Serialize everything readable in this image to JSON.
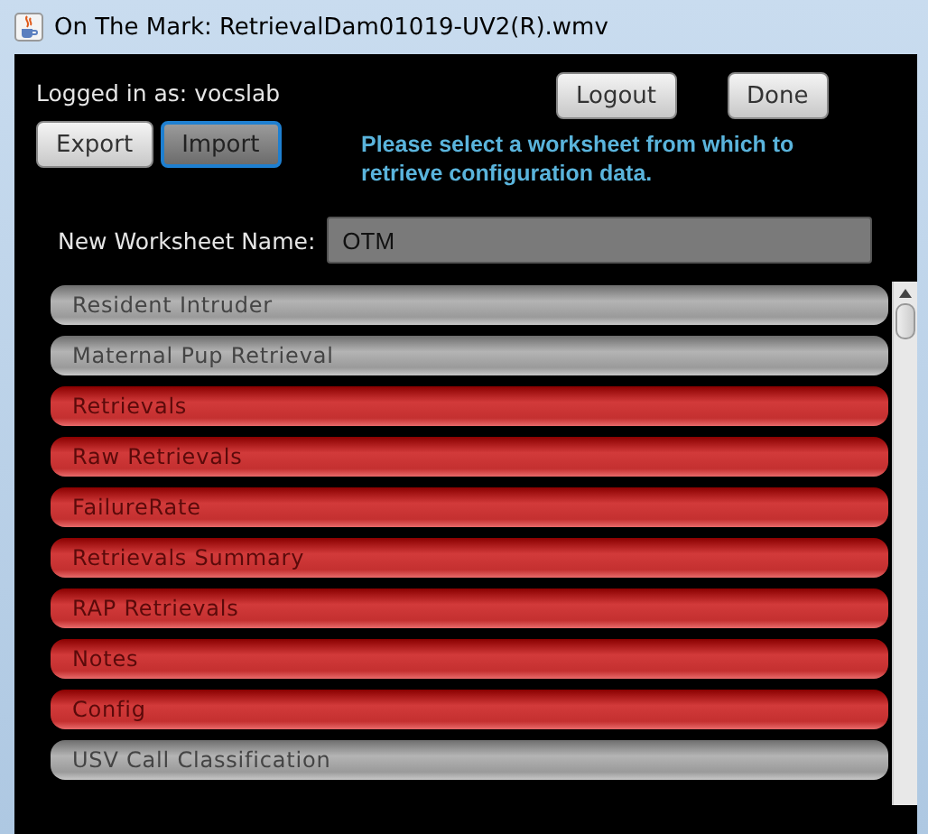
{
  "window": {
    "title": "On The Mark: RetrievalDam01019-UV2(R).wmv"
  },
  "login": {
    "label": "Logged in as: vocslab"
  },
  "top_buttons": [
    {
      "label": "Logout",
      "focused": false
    },
    {
      "label": "Done",
      "focused": false
    }
  ],
  "mode_buttons": [
    {
      "label": "Export",
      "focused": false
    },
    {
      "label": "Import",
      "focused": true
    }
  ],
  "message": "Please select a worksheet from which to retrieve configuration data.",
  "worksheet_name": {
    "label": "New Worksheet Name:",
    "value": "OTM"
  },
  "items": [
    {
      "label": "Resident Intruder",
      "kind": "workbook"
    },
    {
      "label": "Maternal Pup Retrieval",
      "kind": "workbook"
    },
    {
      "label": "Retrievals",
      "kind": "sheet"
    },
    {
      "label": "Raw Retrievals",
      "kind": "sheet"
    },
    {
      "label": "FailureRate",
      "kind": "sheet"
    },
    {
      "label": "Retrievals Summary",
      "kind": "sheet"
    },
    {
      "label": "RAP Retrievals",
      "kind": "sheet"
    },
    {
      "label": "Notes",
      "kind": "sheet"
    },
    {
      "label": "Config",
      "kind": "sheet"
    },
    {
      "label": "USV Call Classification",
      "kind": "workbook"
    }
  ]
}
